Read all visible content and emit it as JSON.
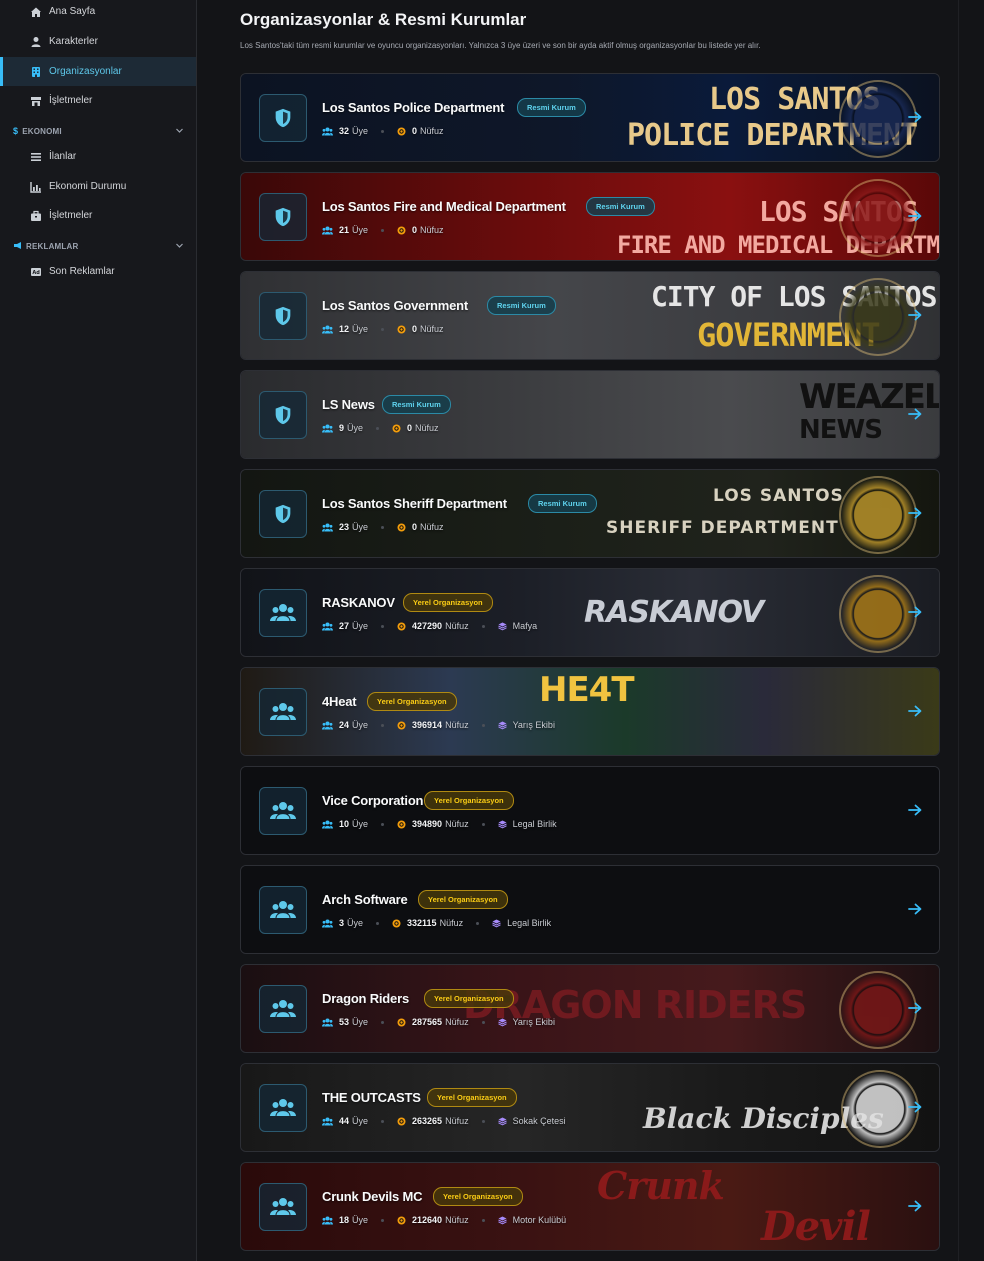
{
  "sidebar": {
    "items": [
      {
        "label": "Ana Sayfa",
        "icon": "home-icon"
      },
      {
        "label": "Karakterler",
        "icon": "user-icon"
      },
      {
        "label": "Organizasyonlar",
        "icon": "building-icon",
        "active": true
      },
      {
        "label": "İşletmeler",
        "icon": "store-icon"
      }
    ],
    "section_economy": {
      "label": "EKONOMI",
      "icon": "dollar-icon"
    },
    "economy_items": [
      {
        "label": "İlanlar",
        "icon": "list-icon"
      },
      {
        "label": "Ekonomi Durumu",
        "icon": "chart-icon"
      },
      {
        "label": "İşletmeler",
        "icon": "briefcase-icon"
      }
    ],
    "section_ads": {
      "label": "REKLAMLAR",
      "icon": "megaphone-icon"
    },
    "ads_items": [
      {
        "label": "Son Reklamlar",
        "icon": "ad-icon"
      }
    ]
  },
  "header": {
    "title": "Organizasyonlar & Resmi Kurumlar",
    "description": "Los Santos'taki tüm resmi kurumlar ve oyuncu organizasyonları. Yalnızca 3 üye üzeri ve son bir ayda aktif olmuş organizasyonlar bu listede yer alır."
  },
  "labels": {
    "members": "Üye",
    "influence": "Nüfuz"
  },
  "organizations": [
    {
      "name": "Los Santos Police Department",
      "badge": "Resmi Kurum",
      "members": "32",
      "influence": "0",
      "banner_top": "LOS SANTOS",
      "banner_bottom": "POLICE DEPARTMENT"
    },
    {
      "name": "Los Santos Fire and Medical Department",
      "badge": "Resmi Kurum",
      "members": "21",
      "influence": "0",
      "banner_top": "LOS SANTOS",
      "banner_bottom": "FIRE AND MEDICAL DEPARTMENT"
    },
    {
      "name": "Los Santos Government",
      "badge": "Resmi Kurum",
      "members": "12",
      "influence": "0",
      "banner_top": "CITY OF LOS SANTOS",
      "banner_bottom": "GOVERNMENT"
    },
    {
      "name": "LS News",
      "badge": "Resmi Kurum",
      "members": "9",
      "influence": "0",
      "banner_top": "WEAZEL",
      "banner_bottom": "NEWS"
    },
    {
      "name": "Los Santos Sheriff Department",
      "badge": "Resmi Kurum",
      "members": "23",
      "influence": "0",
      "banner_top": "LOS SANTOS",
      "banner_bottom": "SHERIFF DEPARTMENT"
    },
    {
      "name": "RASKANOV",
      "badge": "Yerel Organizasyon",
      "members": "27",
      "influence": "427290",
      "type": "Mafya",
      "banner_top": "RASKANOV"
    },
    {
      "name": "4Heat",
      "badge": "Yerel Organizasyon",
      "members": "24",
      "influence": "396914",
      "type": "Yarış Ekibi",
      "banner_top": "HE4T"
    },
    {
      "name": "Vice Corporation",
      "badge": "Yerel Organizasyon",
      "members": "10",
      "influence": "394890",
      "type": "Legal Birlik"
    },
    {
      "name": "Arch Software",
      "badge": "Yerel Organizasyon",
      "members": "3",
      "influence": "332115",
      "type": "Legal Birlik"
    },
    {
      "name": "Dragon Riders",
      "badge": "Yerel Organizasyon",
      "members": "53",
      "influence": "287565",
      "type": "Yarış Ekibi",
      "banner_top": "DRAGON RIDERS"
    },
    {
      "name": "THE OUTCASTS",
      "badge": "Yerel Organizasyon",
      "members": "44",
      "influence": "263265",
      "type": "Sokak Çetesi",
      "banner_top": "Black Disciples"
    },
    {
      "name": "Crunk Devils MC",
      "badge": "Yerel Organizasyon",
      "members": "18",
      "influence": "212640",
      "type": "Motor Kulübü",
      "banner_top": "Crunk",
      "banner_bottom": "Devil"
    }
  ],
  "colors": {
    "accent": "#38bdf8",
    "official_badge": "#5fd3ee",
    "local_badge": "#facc15",
    "influence_icon": "#f59e0b",
    "type_icon": "#a78bfa"
  }
}
